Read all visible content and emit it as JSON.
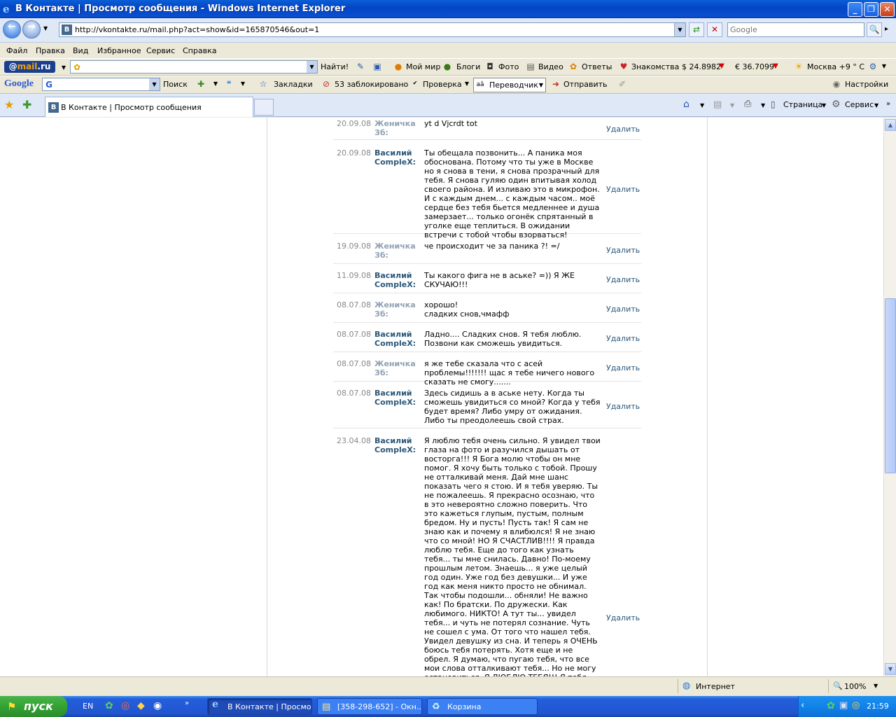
{
  "window": {
    "title": "В Контакте | Просмотр сообщения - Windows Internet Explorer",
    "controls": {
      "minimize": "_",
      "maximize": "❐",
      "close": "✕"
    }
  },
  "address_bar": {
    "url": "http://vkontakte.ru/mail.php?act=show&id=165870546&out=1",
    "search_placeholder": "Google"
  },
  "menu": [
    "Файл",
    "Правка",
    "Вид",
    "Избранное",
    "Сервис",
    "Справка"
  ],
  "mail_toolbar": {
    "find": "Найти!",
    "items": [
      "Мой мир",
      "Блоги",
      "Фото",
      "Видео",
      "Ответы",
      "Знакомства"
    ],
    "usd": "$ 24.8982",
    "eur": "€ 36.7099",
    "weather": "Москва +9 ° C"
  },
  "google_toolbar": {
    "logo": "Google",
    "search": "Поиск",
    "bookmarks": "Закладки",
    "blocked": "53 заблокировано",
    "check": "Проверка",
    "translate": "Переводчик",
    "send": "Отправить",
    "settings": "Настройки"
  },
  "tab": {
    "label": "В Контакте | Просмотр сообщения"
  },
  "command_bar": {
    "page": "Страница",
    "tools": "Сервис"
  },
  "messages": [
    {
      "date": "20.09.08",
      "author": "Женичка Зб:",
      "her": true,
      "text": "yt d Vjcrdt tot",
      "delete": "Удалить"
    },
    {
      "date": "20.09.08",
      "author": "Василий CompleX:",
      "her": false,
      "text": "Ты обещала позвонить... А паника моя обоснована. Потому что ты уже в Москве но я снова в тени, я снова прозрачный для тебя. Я снова гуляю один впитывая холод своего района. И изливаю это в микрофон. И с каждым днем... с каждым часом.. моё сердце без тебя бьется медленнее и душа замерзает... только огонёк спрятанный в уголке еще теплиться. В ожидании встречи с тобой чтобы взорваться!",
      "delete": "Удалить"
    },
    {
      "date": "19.09.08",
      "author": "Женичка Зб:",
      "her": true,
      "text": "че происходит че за паника ?! =/",
      "delete": "Удалить"
    },
    {
      "date": "11.09.08",
      "author": "Василий CompleX:",
      "her": false,
      "text": "Ты какого фига не в аське? =)) Я ЖЕ СКУЧАЮ!!!",
      "delete": "Удалить"
    },
    {
      "date": "08.07.08",
      "author": "Женичка Зб:",
      "her": true,
      "text": "хорошо!\nсладких снов,чмафф",
      "delete": "Удалить"
    },
    {
      "date": "08.07.08",
      "author": "Василий CompleX:",
      "her": false,
      "text": "Ладно.... Сладких снов. Я тебя люблю. Позвони как сможешь увидиться.",
      "delete": "Удалить"
    },
    {
      "date": "08.07.08",
      "author": "Женичка Зб:",
      "her": true,
      "text": "я же тебе сказала что с асей проблемы!!!!!!! щас я тебе ничего нового сказать не смогу.......",
      "delete": "Удалить"
    },
    {
      "date": "08.07.08",
      "author": "Василий CompleX:",
      "her": false,
      "text": "Здесь сидишь а в аське нету. Когда ты сможешь увидиться со мной? Когда у тебя будет время? Либо умру от ожидания. Либо ты преодолеешь свой страх.",
      "delete": "Удалить"
    },
    {
      "date": "23.04.08",
      "author": "Василий CompleX:",
      "her": false,
      "text": "Я люблю тебя очень сильно. Я увидел твои глаза на фото и разучился дышать от восторга!!! Я Бога молю чтобы он мне помог. Я хочу быть только с тобой. Прошу не отталкивай меня. Дай мне шанс показать чего я стою. И я тебя уверяю. Ты не пожалеешь. Я прекрасно осознаю, что в это невероятно сложно поверить. Что это кажеться глупым, пустым, полным бредом. Ну и пусть! Пусть так! Я сам не знаю как и почему я влибюлся! Я не знаю что со мной! НО Я СЧАСТЛИВ!!!! Я правда люблю тебя. Еще до того как узнать тебя... ты мне снилась. Давно! По-моему прошлым летом. Знаешь... я уже целый год один. Уже год без девушки... И уже год как меня никто просто не обнимал. Так чтобы подошли... обняли! Не важно как! По братски. По дружески. Как любимого. НИКТО! А тут ты... увидел тебя... и чуть не потерял сознание. Чуть не сошел с ума. От того что нашел тебя. Увидел девушку из сна. И теперь я ОЧЕНЬ боюсь тебя потерять. Хотя еще и не обрел. Я думаю, что пугаю тебя, что все мои слова отталкивают тебя... Но не могу остановиться. Я ЛЮБЛЮ ТЕБЯ!!! Я тебя люблю! Люблю потому что больше так не могу! Потому что устал быть один, устал тонуть в",
      "delete": "Удалить"
    }
  ],
  "status_bar": {
    "zone": "Интернет",
    "zoom": "100%"
  },
  "taskbar": {
    "start": "пуск",
    "lang": "EN",
    "tasks": [
      "В Контакте | Просмо...",
      "[358-298-652] - Окн...",
      "Корзина"
    ],
    "clock": "21:59"
  }
}
